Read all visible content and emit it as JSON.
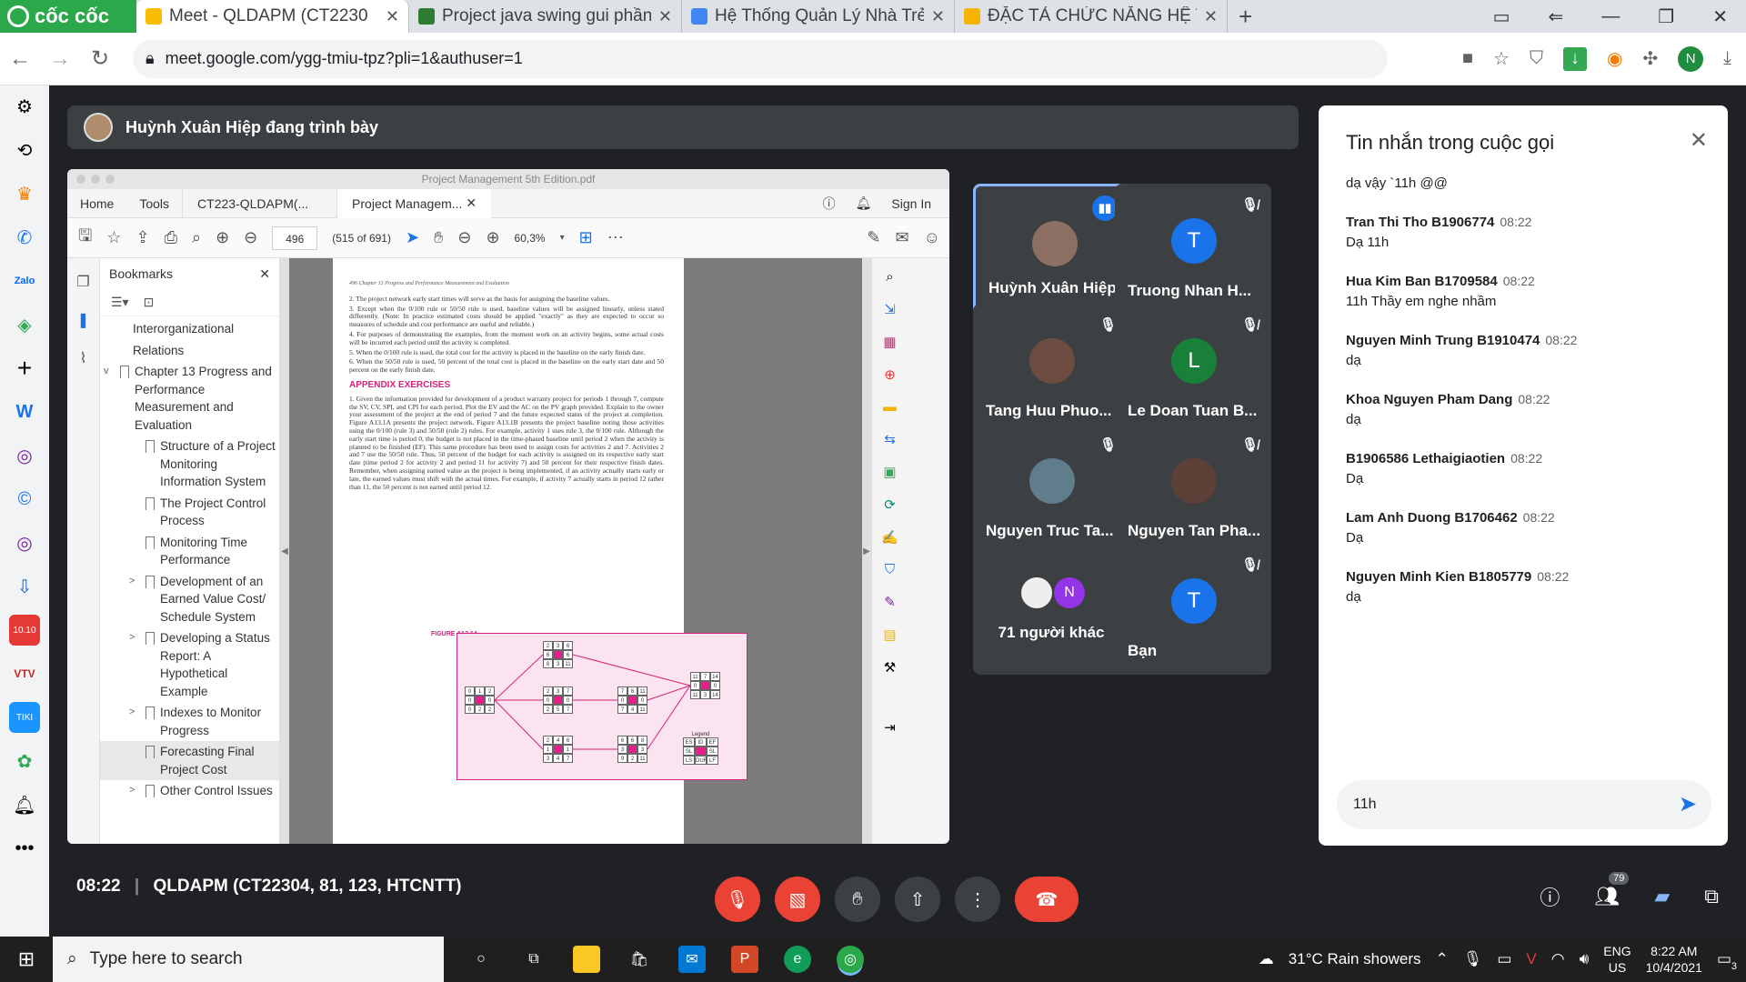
{
  "browser": {
    "brand": "cốc cốc",
    "tabs": [
      {
        "title": "Meet - QLDAPM (CT2230",
        "color": "#fbbc04",
        "active": true
      },
      {
        "title": "Project java swing gui phần n",
        "color": "#2e7d32",
        "active": false
      },
      {
        "title": "Hệ Thống Quản Lý Nhà Trẻ (I",
        "color": "#4285f4",
        "active": false
      },
      {
        "title": "ĐẶC TẢ CHỨC NĂNG HỆ THỐ",
        "color": "#f4b400",
        "active": false
      }
    ],
    "url": "meet.google.com/ygg-tmiu-tpz?pli=1&authuser=1",
    "profile_initial": "N"
  },
  "presenter_bar": {
    "text": "Huỳnh Xuân Hiệp đang trình bày"
  },
  "pdf": {
    "window_title": "Project Management 5th Edition.pdf",
    "menu": {
      "home": "Home",
      "tools": "Tools",
      "tab1": "CT223-QLDAPM(...",
      "tab2": "Project Managem...",
      "sign_in": "Sign In"
    },
    "page_number": "496",
    "page_count": "(515 of 691)",
    "zoom": "60,3%",
    "bookmarks_title": "Bookmarks",
    "bookmarks": [
      {
        "text": "Interorganizational",
        "indent": 1,
        "chev": ""
      },
      {
        "text": "Relations",
        "indent": 1,
        "chev": ""
      },
      {
        "text": "Chapter 13 Progress and Performance Measurement and Evaluation",
        "indent": 0,
        "chev": "v"
      },
      {
        "text": "Structure of a Project Monitoring Information System",
        "indent": 2,
        "chev": ""
      },
      {
        "text": "The Project Control Process",
        "indent": 2,
        "chev": ""
      },
      {
        "text": "Monitoring Time Performance",
        "indent": 2,
        "chev": ""
      },
      {
        "text": "Development of an Earned Value Cost/ Schedule System",
        "indent": 2,
        "chev": ">"
      },
      {
        "text": "Developing a Status Report: A Hypothetical Example",
        "indent": 2,
        "chev": ">"
      },
      {
        "text": "Indexes to Monitor Progress",
        "indent": 2,
        "chev": ">"
      },
      {
        "text": "Forecasting Final Project Cost",
        "indent": 2,
        "chev": "",
        "selected": true
      },
      {
        "text": "Other Control Issues",
        "indent": 2,
        "chev": ">"
      }
    ],
    "page": {
      "header": "496   Chapter 13   Progress and Performance Measurement and Evaluation",
      "items": [
        "2. The project network early start times will serve as the basis for assigning the baseline values.",
        "3. Except when the 0/100 rule or 50/50 rule is used, baseline values will be assigned linearly, unless stated differently. (Note: In practice estimated costs should be applied \"exactly\" as they are expected to occur so measures of schedule and cost performance are useful and reliable.)",
        "4. For purposes of demonstrating the examples, from the moment work on an activity begins, some actual costs will be incurred each period until the activity is completed.",
        "5. When the 0/100 rule is used, the total cost for the activity is placed in the baseline on the early finish date.",
        "6. When the 50/50 rule is used, 50 percent of the total cost is placed in the baseline on the early start date and 50 percent on the early finish date."
      ],
      "heading": "APPENDIX EXERCISES",
      "exercise": "1. Given the information provided for development of a product warranty project for periods 1 through 7, compute the SV, CV, SPI, and CPI for each period. Plot the EV and the AC on the PV graph provided. Explain to the owner your assessment of the project at the end of period 7 and the future expected status of the project at completion. Figure A13.1A presents the project network. Figure A13.1B presents the project baseline noting those activities using the 0/100 (rule 3) and 50/50 (rule 2) rules. For example, activity 1 uses rule 3, the 0/100 rule. Although the early start time is period 0, the budget is not placed in the time-phased baseline until period 2 when the activity is planned to be finished (EF). This same procedure has been used to assign costs for activities 2 and 7. Activities 2 and 7 use the 50/50 rule. Thus, 50 percent of the budget for each activity is assigned on its respective early start date (time period 2 for activity 2 and period 11 for activity 7) and 50 percent for their respective finish dates. Remember, when assigning earned value as the project is being implemented, if an activity actually starts early or late, the earned values must shift with the actual times. For example, if activity 7 actually starts in period 12 rather than 11, the 50 percent is not earned until period 12.",
      "figure_label": "FIGURE A13.1A",
      "legend": {
        "title": "Legend",
        "r1": [
          "ES",
          "ID",
          "EF"
        ],
        "r2": [
          "SL",
          "",
          "SL"
        ],
        "r3": [
          "LS",
          "DUR",
          "LF"
        ]
      },
      "nodes": [
        {
          "top": [
            "2",
            "3",
            "6"
          ],
          "mid": [
            "6",
            "",
            "6"
          ],
          "bot": [
            "8",
            "3",
            "11"
          ]
        },
        {
          "top": [
            "0",
            "1",
            "2"
          ],
          "mid": [
            "0",
            "",
            "0"
          ],
          "bot": [
            "0",
            "2",
            "2"
          ]
        },
        {
          "top": [
            "2",
            "3",
            "7"
          ],
          "mid": [
            "0",
            "",
            "0"
          ],
          "bot": [
            "2",
            "5",
            "7"
          ]
        },
        {
          "top": [
            "7",
            "6",
            "11"
          ],
          "mid": [
            "0",
            "",
            "0"
          ],
          "bot": [
            "7",
            "4",
            "11"
          ]
        },
        {
          "top": [
            "11",
            "7",
            "14"
          ],
          "mid": [
            "0",
            "",
            "0"
          ],
          "bot": [
            "11",
            "3",
            "14"
          ]
        },
        {
          "top": [
            "2",
            "4",
            "6"
          ],
          "mid": [
            "1",
            "",
            "1"
          ],
          "bot": [
            "3",
            "4",
            "7"
          ]
        },
        {
          "top": [
            "6",
            "6",
            "8"
          ],
          "mid": [
            "3",
            "",
            "3"
          ],
          "bot": [
            "9",
            "2",
            "11"
          ]
        }
      ]
    }
  },
  "participants": [
    {
      "name": "Huỳnh Xuân Hiệp",
      "speaking": true,
      "avatar": "photo",
      "color": "#8d6e63"
    },
    {
      "name": "Truong Nhan H...",
      "muted": true,
      "initial": "T",
      "color": "#1a73e8"
    },
    {
      "name": "Tang Huu Phuo...",
      "muted": true,
      "avatar": "photo",
      "color": "#6d4c41"
    },
    {
      "name": "Le Doan Tuan B...",
      "muted": true,
      "initial": "L",
      "color": "#188038"
    },
    {
      "name": "Nguyen Truc Ta...",
      "muted": true,
      "avatar": "photo",
      "color": "#607d8b"
    },
    {
      "name": "Nguyen Tan Pha...",
      "muted": true,
      "avatar": "photo",
      "color": "#5d4037"
    },
    {
      "name": "71 người khác",
      "others": true,
      "initial": "N",
      "color": "#9334e6"
    },
    {
      "name": "Bạn",
      "muted": true,
      "initial": "T",
      "color": "#1a73e8"
    }
  ],
  "chat": {
    "title": "Tin nhắn trong cuộc gọi",
    "top_text": "dạ vậy `11h @@",
    "messages": [
      {
        "sender": "Tran Thi Tho B1906774",
        "time": "08:22",
        "text": "Dạ 11h"
      },
      {
        "sender": "Hua Kim Ban B1709584",
        "time": "08:22",
        "text": "11h Thầy em nghe nhầm"
      },
      {
        "sender": "Nguyen Minh Trung B1910474",
        "time": "08:22",
        "text": "dạ"
      },
      {
        "sender": "Khoa Nguyen Pham Dang",
        "time": "08:22",
        "text": "dạ"
      },
      {
        "sender": "B1906586 Lethaigiaotien",
        "time": "08:22",
        "text": "Dạ"
      },
      {
        "sender": "Lam Anh Duong B1706462",
        "time": "08:22",
        "text": "Dạ"
      },
      {
        "sender": "Nguyen Minh Kien B1805779",
        "time": "08:22",
        "text": "dạ"
      }
    ],
    "input_value": "11h"
  },
  "bottom": {
    "time": "08:22",
    "meeting_name": "QLDAPM (CT22304, 81, 123, HTCNTT)",
    "people_count": "79"
  },
  "taskbar": {
    "search_placeholder": "Type here to search",
    "weather": "31°C  Rain showers",
    "lang1": "ENG",
    "lang2": "US",
    "time": "8:22 AM",
    "date": "10/4/2021",
    "notif": "3"
  }
}
